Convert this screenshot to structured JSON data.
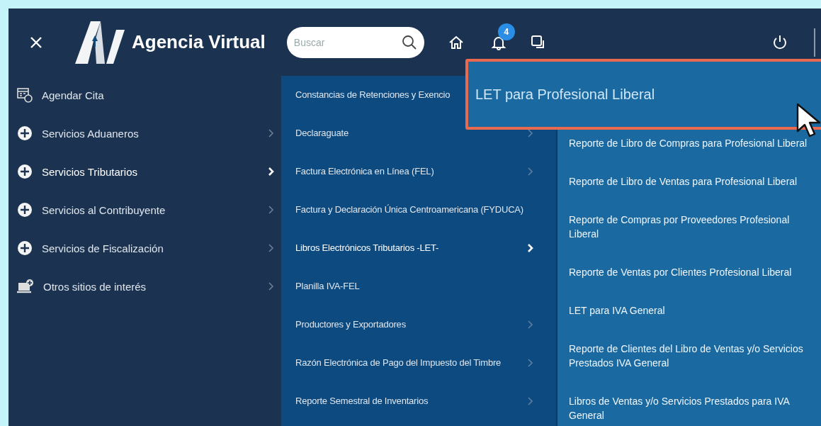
{
  "header": {
    "brand": "Agencia Virtual",
    "search": {
      "placeholder": "Buscar"
    },
    "notifications": {
      "badge": "4"
    }
  },
  "sidebar": {
    "items": [
      {
        "label": "Agendar Cita",
        "kind": "calendar",
        "has_submenu": false,
        "selected": false
      },
      {
        "label": "Servicios Aduaneros",
        "kind": "plus",
        "has_submenu": true,
        "selected": false
      },
      {
        "label": "Servicios Tributarios",
        "kind": "plus",
        "has_submenu": true,
        "selected": true
      },
      {
        "label": "Servicios al Contribuyente",
        "kind": "plus",
        "has_submenu": true,
        "selected": false
      },
      {
        "label": "Servicios de Fiscalización",
        "kind": "plus",
        "has_submenu": true,
        "selected": false
      },
      {
        "label": "Otros sitios de interés",
        "kind": "laptop",
        "has_submenu": true,
        "selected": false
      }
    ]
  },
  "submenu": {
    "items": [
      {
        "label": "Constancias de Retenciones y Exencio",
        "has_submenu": false,
        "selected": false
      },
      {
        "label": "Declaraguate",
        "has_submenu": true,
        "selected": false
      },
      {
        "label": "Factura Electrónica en Línea (FEL)",
        "has_submenu": true,
        "selected": false
      },
      {
        "label": "Factura y Declaración Única Centroamericana (FYDUCA)",
        "has_submenu": false,
        "selected": false
      },
      {
        "label": "Libros Electrónicos Tributarios -LET-",
        "has_submenu": true,
        "selected": true
      },
      {
        "label": "Planilla IVA-FEL",
        "has_submenu": false,
        "selected": false
      },
      {
        "label": "Productores y Exportadores",
        "has_submenu": true,
        "selected": false
      },
      {
        "label": "Razón Electrónica de Pago del Impuesto del Timbre",
        "has_submenu": true,
        "selected": false
      },
      {
        "label": "Reporte Semestral de Inventarios",
        "has_submenu": true,
        "selected": false
      }
    ]
  },
  "subsubmenu": {
    "items": [
      {
        "label": "Reporte de Libro de Compras para Profesional Liberal"
      },
      {
        "label": "Reporte de Libro de Ventas para Profesional Liberal"
      },
      {
        "label": "Reporte de Compras por Proveedores Profesional Liberal"
      },
      {
        "label": "Reporte de Ventas por Clientes Profesional Liberal"
      },
      {
        "label": "LET para IVA General"
      },
      {
        "label": "Reporte de Clientes del Libro de Ventas y/o Servicios Prestados IVA General"
      },
      {
        "label": "Libros de Ventas y/o Servicios Prestados para IVA General"
      }
    ]
  },
  "callout": {
    "text": "LET para Profesional Liberal"
  }
}
